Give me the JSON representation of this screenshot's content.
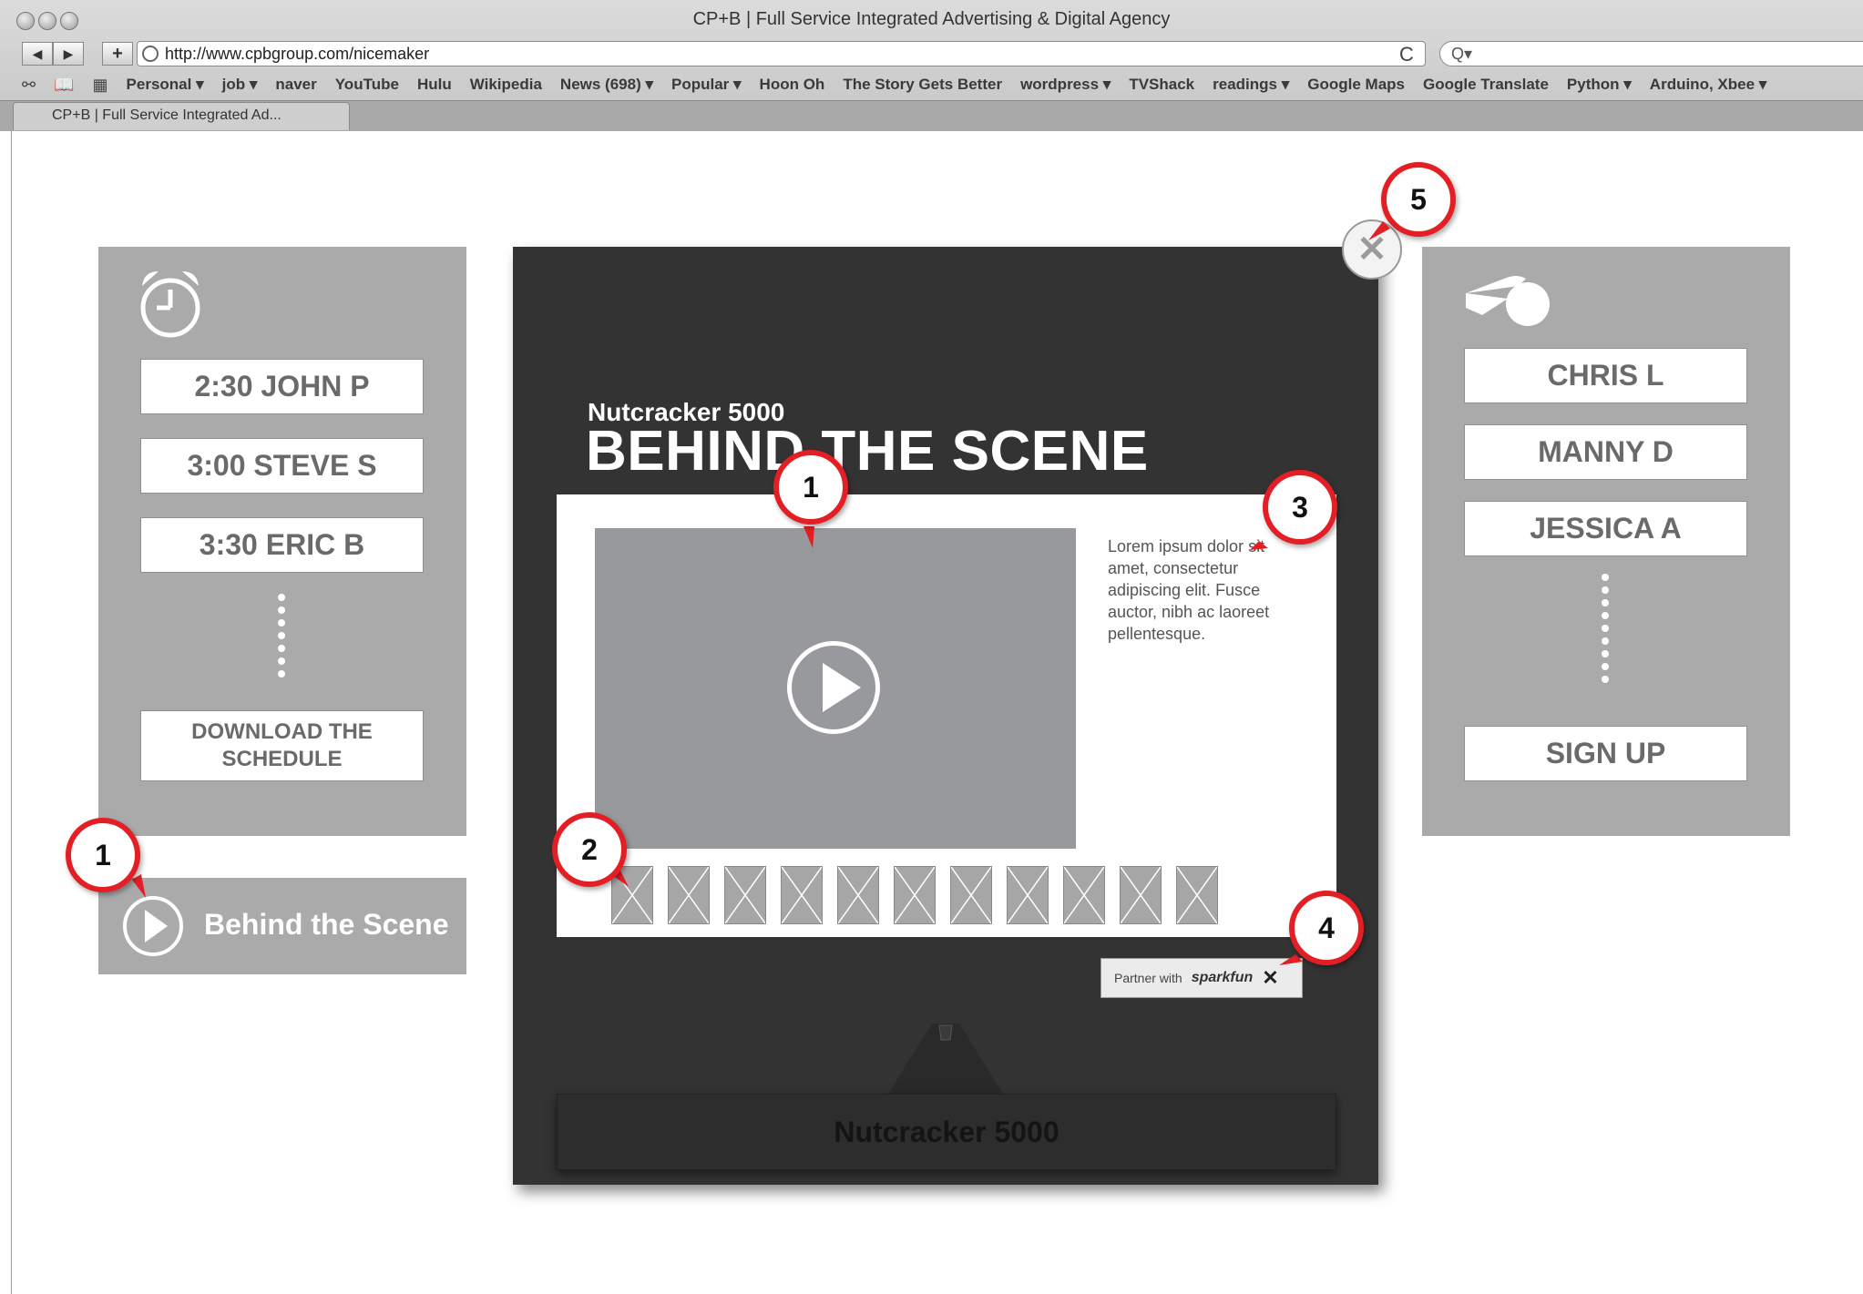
{
  "browser": {
    "window_title": "CP+B | Full Service Integrated Advertising & Digital Agency",
    "back_label": "◀",
    "forward_label": "▶",
    "add_label": "+",
    "url": "http://www.cpbgroup.com/nicemaker",
    "reload_label": "C",
    "search_placeholder": "Q▾",
    "bookmarks": [
      "Personal ▾",
      "job ▾",
      "naver",
      "YouTube",
      "Hulu",
      "Wikipedia",
      "News (698) ▾",
      "Popular ▾",
      "Hoon Oh",
      "The Story Gets Better",
      "wordpress ▾",
      "TVShack",
      "readings ▾",
      "Google Maps",
      "Google Translate",
      "Python ▾",
      "Arduino, Xbee ▾"
    ],
    "bookmark_icons": [
      "reading-glasses-icon",
      "book-icon",
      "grid-icon"
    ],
    "tab_title": "CP+B | Full Service Integrated Ad..."
  },
  "schedule": {
    "icon": "alarm-clock-icon",
    "items": [
      "2:30 JOHN P",
      "3:00 STEVE S",
      "3:30 ERIC B"
    ],
    "download_line1": "DOWNLOAD THE",
    "download_line2": "SCHEDULE"
  },
  "behind_button": {
    "icon": "play-icon",
    "label": "Behind the Scene"
  },
  "modal": {
    "subtitle": "Nutcracker 5000",
    "title": "BEHIND THE SCENE",
    "description": "Lorem ipsum dolor sit amet, consectetur adipiscing elit. Fusce auctor, nibh ac laoreet pellentesque.",
    "thumbnail_count": 11,
    "partner_prefix": "Partner with",
    "partner_logo": "sparkfun",
    "partner_logo2": "✕",
    "plaque": "Nutcracker 5000",
    "close_label": "✕"
  },
  "signups": {
    "icon": "whistle-icon",
    "names": [
      "CHRIS L",
      "MANNY D",
      "JESSICA A"
    ],
    "signup_label": "SIGN UP"
  },
  "callouts": [
    "1",
    "1",
    "2",
    "3",
    "4",
    "5"
  ],
  "colors": {
    "callout_ring": "#e31e24",
    "panel_gray": "#aaaaaa",
    "modal_dark": "#333333",
    "video_gray": "#98999c"
  }
}
